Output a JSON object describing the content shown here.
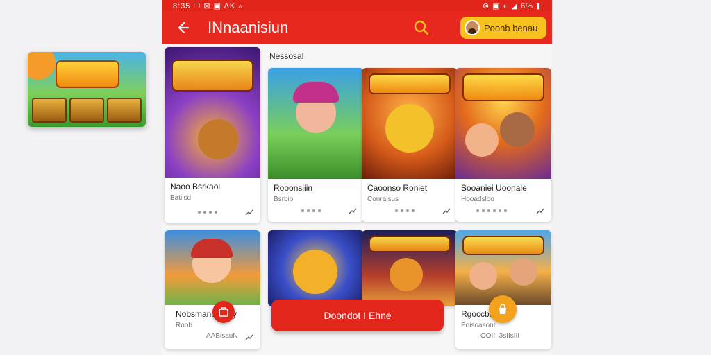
{
  "status_bar": {
    "left": "8:35 ☐ ⊠ ▣  ΔΚ ▵",
    "right": "⊗ ▣ ◐ ◢ 6% ▮"
  },
  "app_bar": {
    "title": "INnaanisiun",
    "account_label": "Poonb benau"
  },
  "side_promo": {
    "logo_text": "GRAAINAN"
  },
  "section_label": "Nessosal",
  "cards": [
    {
      "art_title": "RLOPN DRAAAN",
      "name": "Naoo Bsrkaol",
      "sub": "Batiisd"
    },
    {
      "art_title": "",
      "name": "Rooonsiiin",
      "sub": "Bsrbio"
    },
    {
      "art_title": "DUMBNGRO",
      "name": "Caoonso Roniet",
      "sub": "Conraisus"
    },
    {
      "art_title": "EAIIIABACN",
      "name": "Sooaniei Uoonale",
      "sub": "Hooadsloo"
    },
    {
      "art_title": "",
      "name": "Nobsmanoo Ssy",
      "sub": "Roob",
      "extra": "AABisauN"
    },
    {
      "art_title": "",
      "name": "",
      "sub": ""
    },
    {
      "art_title": "Dhesmcrkou",
      "name": "",
      "sub": ""
    },
    {
      "art_title": "DNIIAHRE",
      "name": "Rgoccbrs",
      "sub": "Poisoasonr",
      "extra": "OOIII 3sIIsIII"
    }
  ],
  "cta_label": "Doondot I Ehne",
  "colors": {
    "brand_red": "#e8281e",
    "accent_yellow": "#f7c21f",
    "accent_orange": "#f2a21c"
  },
  "icons": [
    "back-arrow-icon",
    "search-icon",
    "avatar",
    "trend-icon",
    "store-icon",
    "bag-icon"
  ]
}
